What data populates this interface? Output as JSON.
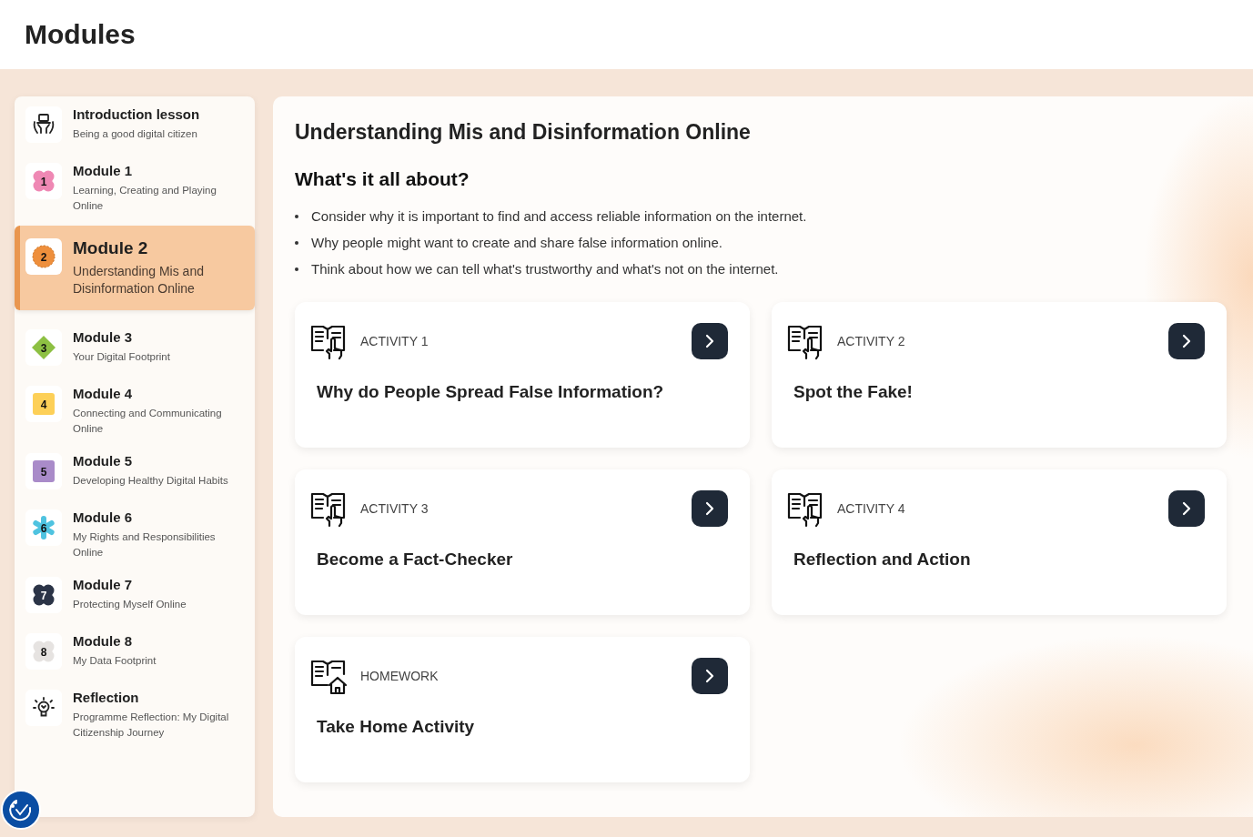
{
  "page_title": "Modules",
  "sidebar": {
    "items": [
      {
        "kind": "laptop",
        "title": "Introduction lesson",
        "subtitle": "Being a good digital citizen",
        "selected": false
      },
      {
        "kind": "flower",
        "badge": "1",
        "color": "#ef88b4",
        "title": "Module 1",
        "subtitle": "Learning, Creating and Playing Online",
        "selected": false
      },
      {
        "kind": "circle",
        "badge": "2",
        "color": "#ee8f3c",
        "title": "Module 2",
        "subtitle": "Understanding Mis and Disinformation Online",
        "selected": true
      },
      {
        "kind": "diamond",
        "badge": "3",
        "color": "#8dc043",
        "title": "Module 3",
        "subtitle": "Your Digital Footprint",
        "selected": false
      },
      {
        "kind": "square",
        "badge": "4",
        "color": "#fdd058",
        "title": "Module 4",
        "subtitle": "Connecting and Communicating Online",
        "selected": false
      },
      {
        "kind": "square",
        "badge": "5",
        "color": "#a98bc9",
        "title": "Module 5",
        "subtitle": "Developing Healthy Digital Habits",
        "selected": false
      },
      {
        "kind": "star",
        "badge": "6",
        "color": "#4fc3e0",
        "title": "Module 6",
        "subtitle": "My Rights and Responsibilities Online",
        "selected": false
      },
      {
        "kind": "flower",
        "badge": "7",
        "color": "#2b3447",
        "title": "Module 7",
        "subtitle": "Protecting Myself Online",
        "selected": false
      },
      {
        "kind": "flower",
        "badge": "8",
        "color": "#e6e3e1",
        "title": "Module 8",
        "subtitle": "My Data Footprint",
        "selected": false
      },
      {
        "kind": "bulb",
        "title": "Reflection",
        "subtitle": "Programme Reflection: My Digital Citizenship Journey",
        "selected": false
      }
    ]
  },
  "main": {
    "title": "Understanding Mis and Disinformation Online",
    "subtitle": "What's it all about?",
    "bullets": [
      "Consider why it is important to find and access reliable information on the internet.",
      "Why people might want to create and share false information online.",
      "Think about how we can tell what's trustworthy and what's not on the internet."
    ],
    "cards": [
      {
        "kind": "activity",
        "label": "ACTIVITY 1",
        "title": "Why do People Spread False Information?"
      },
      {
        "kind": "activity",
        "label": "ACTIVITY 2",
        "title": "Spot the Fake!"
      },
      {
        "kind": "activity",
        "label": "ACTIVITY 3",
        "title": "Become a Fact-Checker"
      },
      {
        "kind": "activity",
        "label": "ACTIVITY 4",
        "title": "Reflection and Action"
      },
      {
        "kind": "homework",
        "label": "HOMEWORK",
        "title": "Take Home Activity"
      }
    ]
  }
}
